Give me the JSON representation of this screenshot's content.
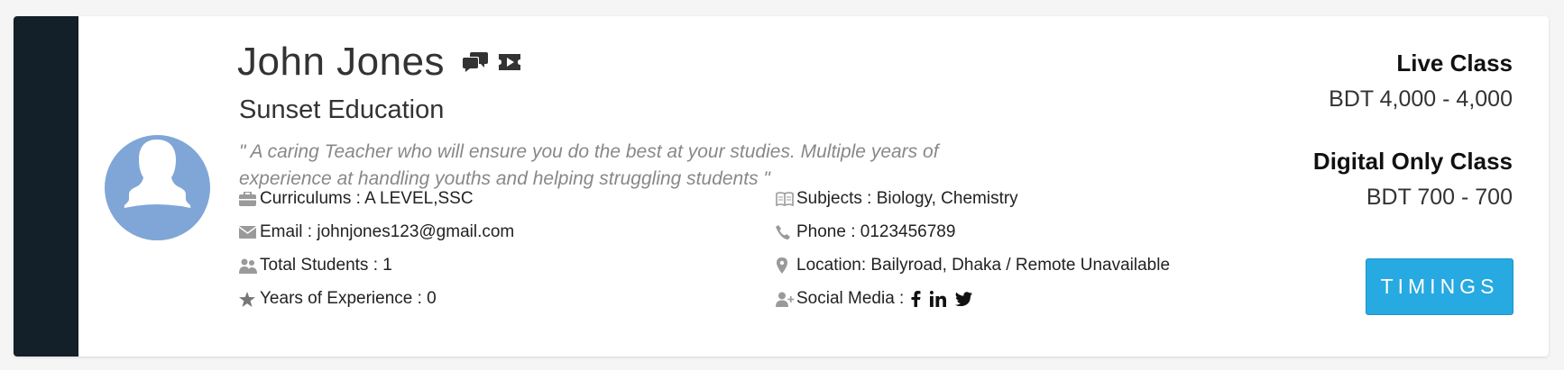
{
  "profile": {
    "name": "John Jones",
    "organization": "Sunset Education",
    "quote": "\" A caring Teacher who will ensure you do the best at your studies. Multiple years of experience at handling youths and helping struggling students \"",
    "header_icons": [
      "chat-bubbles-icon",
      "video-ticket-icon"
    ],
    "avatar_icon": "user-silhouette-icon"
  },
  "details_left": [
    {
      "icon": "briefcase-icon",
      "text": "Curriculums : A LEVEL,SSC"
    },
    {
      "icon": "envelope-icon",
      "text": "Email : johnjones123@gmail.com"
    },
    {
      "icon": "users-icon",
      "text": "Total Students : 1"
    },
    {
      "icon": "star-icon",
      "text": "Years of Experience : 0"
    }
  ],
  "details_right": [
    {
      "icon": "book-icon",
      "text": "Subjects : Biology, Chemistry"
    },
    {
      "icon": "phone-icon",
      "text": "Phone : 0123456789"
    },
    {
      "icon": "map-pin-icon",
      "text": "Location: Bailyroad, Dhaka / Remote Unavailable"
    },
    {
      "icon": "user-plus-icon",
      "text": "Social Media :"
    }
  ],
  "social_icons": [
    "facebook-icon",
    "linkedin-icon",
    "twitter-icon"
  ],
  "pricing": {
    "live_title": "Live Class",
    "live_value": "BDT 4,000 - 4,000",
    "digital_title": "Digital Only Class",
    "digital_value": "BDT 700 - 700"
  },
  "actions": {
    "timings_label": "TIMINGS"
  },
  "colors": {
    "sidebar": "#131f29",
    "avatar_bg": "#7fa6d6",
    "button": "#27a9e1"
  }
}
